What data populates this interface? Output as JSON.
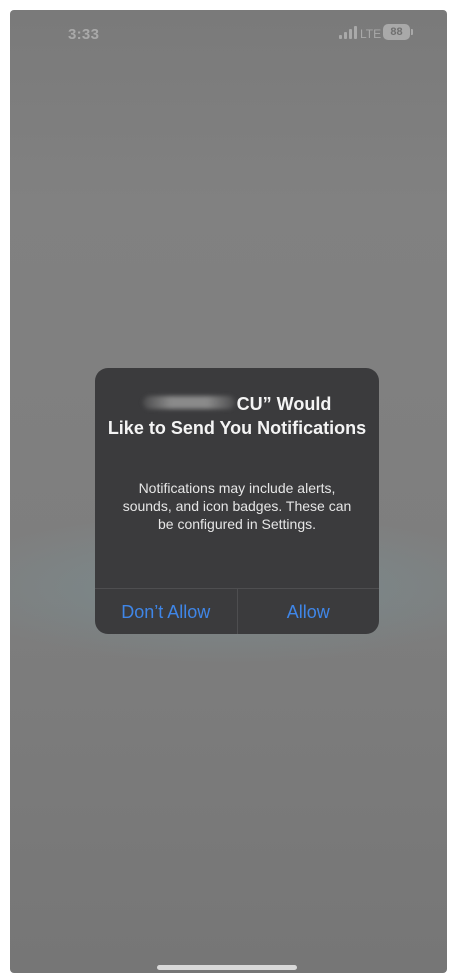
{
  "status_bar": {
    "time": "3:33",
    "network": "LTE",
    "battery_level": "88",
    "signal_icon": "cellular-signal-icon",
    "battery_icon": "battery-icon"
  },
  "alert": {
    "title_app_suffix": "CU” Would",
    "title_rest": "Like to Send You Notifications",
    "message": "Notifications may include alerts, sounds, and icon badges. These can be configured in Settings.",
    "buttons": {
      "deny_label": "Don’t Allow",
      "allow_label": "Allow"
    }
  },
  "colors": {
    "accent": "#3f86e8",
    "alert_background": "#3b3b3d",
    "dimmed_background": "#7e7e7e"
  }
}
